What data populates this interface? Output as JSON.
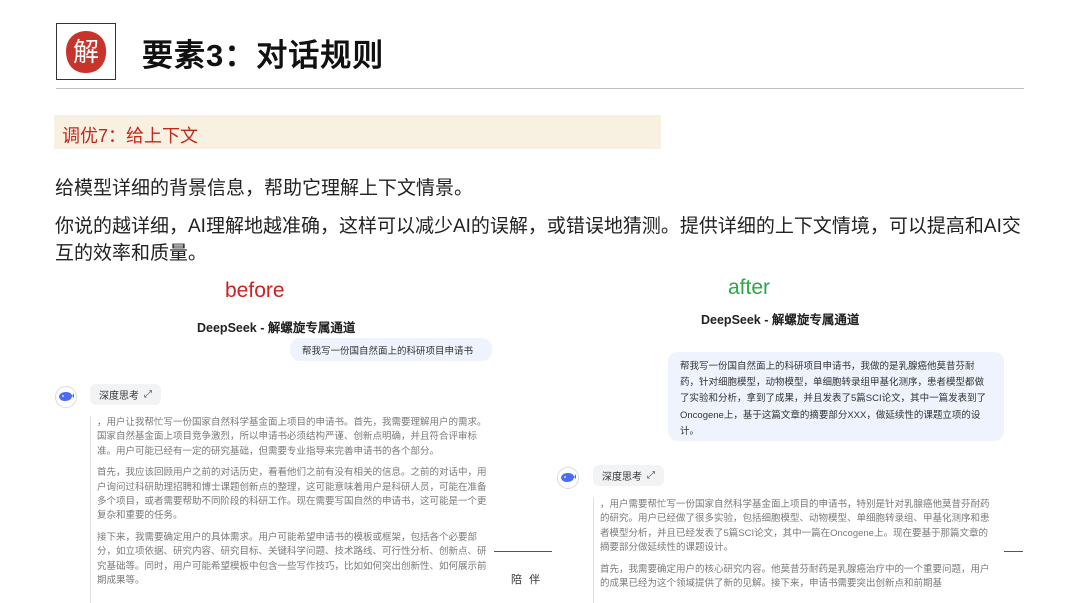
{
  "slide": {
    "title": "要素3：对话规则",
    "logo_char": "解"
  },
  "tuning": {
    "label": "调优7：给上下文"
  },
  "intro": {
    "line1": "给模型详细的背景信息，帮助它理解上下文情景。",
    "line2": "你说的越详细，AI理解地越准确，这样可以减少AI的误解，或错误地猜测。提供详细的上下文情境，可以提高和AI交互的效率和质量。"
  },
  "before": {
    "label": "before",
    "chat_title": "DeepSeek - 解螺旋专属通道",
    "user_message": "帮我写一份国自然面上的科研项目申请书",
    "thinking_chip": "深度思考",
    "thinking": [
      "，用户让我帮忙写一份国家自然科学基金面上项目的申请书。首先，我需要理解用户的需求。国家自然基金面上项目竞争激烈，所以申请书必须结构严谨、创新点明确，并且符合评审标准。用户可能已经有一定的研究基础，但需要专业指导来完善申请书的各个部分。",
      "首先，我应该回顾用户之前的对话历史，看看他们之前有没有相关的信息。之前的对话中，用户询问过科研助理招聘和博士课题创新点的整理，这可能意味着用户是科研人员，可能在准备多个项目，或者需要帮助不同阶段的科研工作。现在需要写国自然的申请书，这可能是一个更复杂和重要的任务。",
      "接下来，我需要确定用户的具体需求。用户可能希望申请书的模板或框架，包括各个必要部分，如立项依据、研究内容、研究目标、关键科学问题、技术路线、可行性分析、创新点、研究基础等。同时，用户可能希望模板中包含一些写作技巧，比如如何突出创新性、如何展示前期成果等。"
    ]
  },
  "after": {
    "label": "after",
    "chat_title": "DeepSeek - 解螺旋专属通道",
    "user_message": "帮我写一份国自然面上的科研项目申请书，我做的是乳腺癌他莫昔芬耐药，针对细胞模型，动物模型，单细胞转录组甲基化测序，患者模型都做了实验和分析，拿到了成果，并且发表了5篇SCI论文，其中一篇发表到了Oncogene上，基于这篇文章的摘要部分XXX，做延续性的课题立项的设计。",
    "thinking_chip": "深度思考",
    "thinking": [
      "，用户需要帮忙写一份国家自然科学基金面上项目的申请书，特别是针对乳腺癌他莫昔芬耐药的研究。用户已经做了很多实验，包括细胞模型、动物模型、单细胞转录组、甲基化测序和患者模型分析，并且已经发表了5篇SCI论文，其中一篇在Oncogene上。现在要基于那篇文章的摘要部分做延续性的课题设计。",
      "首先，我需要确定用户的核心研究内容。他莫昔芬耐药是乳腺癌治疗中的一个重要问题，用户的成果已经为这个领域提供了新的见解。接下来，申请书需要突出创新点和前期基"
    ]
  },
  "side_label": "陪伴",
  "colors": {
    "tuning_bg": "#f8f1e2",
    "tuning_text": "#c0281b",
    "before_label": "#d12020",
    "after_label": "#2aa84a",
    "bubble_bg": "#eef3fd",
    "seal_red": "#c8332b"
  },
  "icons": {
    "logo": "red-seal-logo",
    "avatar": "whale-icon",
    "chip_arrow": "expand-arrow-icon"
  }
}
